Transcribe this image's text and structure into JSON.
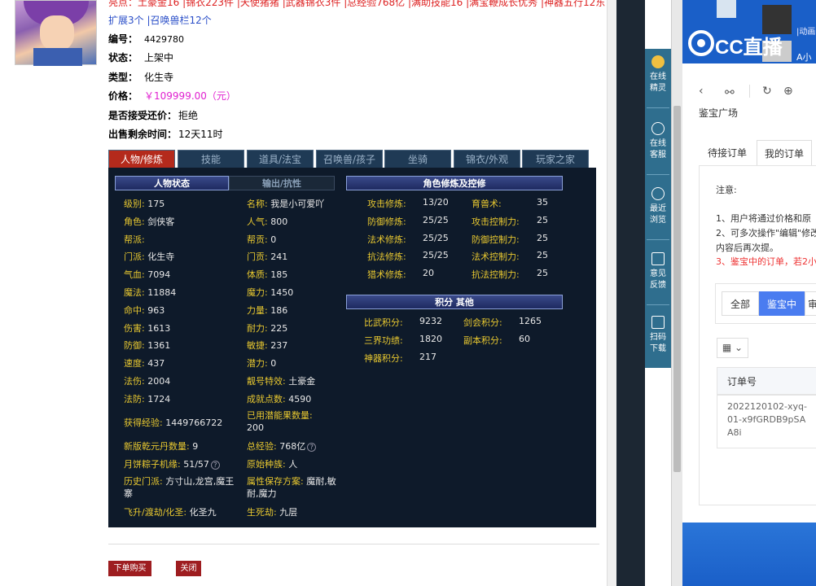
{
  "listing": {
    "top_line1": "亮点：土豪金16 |锦衣223件 |天使猪猪 |武器锦衣3件 |总经验768亿 |满助技能16 |满宝鞭成长优秀 |神器五行12东 |符咒",
    "top_line2": "扩展3个 |召唤兽栏12个",
    "id_label": "编号：",
    "id_value": "4429780",
    "status_label": "状态：",
    "status_value": "上架中",
    "type_label": "类型：",
    "type_value": "化生寺",
    "price_label": "价格：",
    "price_value": "￥109999.00（元）",
    "bargain_label": "是否接受还价：",
    "bargain_value": "拒绝",
    "time_label": "出售剩余时间：",
    "time_value": "12天11时"
  },
  "tabs": [
    "人物/修炼",
    "技能",
    "道具/法宝",
    "召唤兽/孩子",
    "坐骑",
    "锦衣/外观",
    "玩家之家"
  ],
  "panel": {
    "status_header": "人物状态",
    "output_header": "输出/抗性",
    "cultivation_header": "角色修炼及控修",
    "points_header": "积分 其他",
    "left_col": [
      {
        "label": "级别:",
        "value": "175"
      },
      {
        "label": "角色:",
        "value": "剑侠客"
      },
      {
        "label": "帮派:",
        "value": ""
      },
      {
        "label": "门派:",
        "value": "化生寺"
      },
      {
        "label": "气血:",
        "value": "7094"
      },
      {
        "label": "魔法:",
        "value": "11884"
      },
      {
        "label": "命中:",
        "value": "963"
      },
      {
        "label": "伤害:",
        "value": "1613"
      },
      {
        "label": "防御:",
        "value": "1361"
      },
      {
        "label": "速度:",
        "value": "437"
      },
      {
        "label": "法伤:",
        "value": "2004"
      },
      {
        "label": "法防:",
        "value": "1724"
      }
    ],
    "mid_col": [
      {
        "label": "名称:",
        "value": "我是小可爱吖"
      },
      {
        "label": "人气:",
        "value": "800"
      },
      {
        "label": "帮贡:",
        "value": "0"
      },
      {
        "label": "门贡:",
        "value": "241"
      },
      {
        "label": "体质:",
        "value": "185"
      },
      {
        "label": "魔力:",
        "value": "1450"
      },
      {
        "label": "力量:",
        "value": "186"
      },
      {
        "label": "耐力:",
        "value": "225"
      },
      {
        "label": "敏捷:",
        "value": "237"
      },
      {
        "label": "潜力:",
        "value": "0"
      },
      {
        "label": "靓号特效:",
        "value": "土豪金"
      },
      {
        "label": "成就点数:",
        "value": "4590"
      }
    ],
    "extra": {
      "exp_label": "获得经验:",
      "exp_value": "1449766722",
      "fruit_label": "已用潜能果数量:",
      "fruit_value": "200",
      "qianyuan_label": "新版乾元丹数量:",
      "qianyuan_value": "9",
      "totalexp_label": "总经验:",
      "totalexp_value": "768亿",
      "moon_label": "月饼粽子机缘:",
      "moon_value": "51/57",
      "race_label": "原始种族:",
      "race_value": "人",
      "history_label": "历史门派:",
      "history_value": "方寸山,龙宫,魔王寨",
      "attr_label": "属性保存方案:",
      "attr_value": "魔耐,敏耐,魔力",
      "fly_label": "飞升/渡劫/化圣:",
      "fly_value": "化圣九",
      "death_label": "生死劫:",
      "death_value": "九层"
    },
    "cultivation": [
      {
        "l1": "攻击修炼:",
        "v1": "13/20",
        "l2": "育兽术:",
        "v2": "35"
      },
      {
        "l1": "防御修炼:",
        "v1": "25/25",
        "l2": "攻击控制力:",
        "v2": "25"
      },
      {
        "l1": "法术修炼:",
        "v1": "25/25",
        "l2": "防御控制力:",
        "v2": "25"
      },
      {
        "l1": "抗法修炼:",
        "v1": "25/25",
        "l2": "法术控制力:",
        "v2": "25"
      },
      {
        "l1": "猎术修炼:",
        "v1": "20",
        "l2": "抗法控制力:",
        "v2": "25"
      }
    ],
    "points": [
      {
        "l1": "比武积分:",
        "v1": "9232",
        "l2": "剑会积分:",
        "v2": "1265"
      },
      {
        "l1": "三界功绩:",
        "v1": "1820",
        "l2": "副本积分:",
        "v2": "60"
      },
      {
        "l1": "神器积分:",
        "v1": "217",
        "l2": "",
        "v2": ""
      }
    ]
  },
  "buttons": {
    "buy": "下单购买",
    "close": "关闭"
  },
  "sidebar": [
    {
      "label": "在线精灵"
    },
    {
      "label": "在线客服"
    },
    {
      "label": "最近浏览"
    },
    {
      "label": "意见反馈"
    },
    {
      "label": "扫码下载"
    }
  ],
  "right_app": {
    "brand": "CC直播",
    "top_right_1": "|动画",
    "top_right_2": "A小",
    "page_title": "鉴宝广场",
    "tab1": "待接订单",
    "tab2": "我的订单",
    "notice_title": "注意:",
    "notice1": "1、用户将通过价格和原",
    "notice2": "2、可多次操作\"编辑\"修改",
    "notice3": "内容后再次提。",
    "notice4": "3、鉴宝中的订单，若2小",
    "seg_all": "全部",
    "seg_active": "鉴宝中",
    "seg_third": "审",
    "col_order": "订单号",
    "order_no": "2022120102-xyq-01-x9fGRDB9pSAA8i"
  },
  "colors": {
    "accent_red": "#9e1d20",
    "price": "#e020d0",
    "panel_bg": "#0e1a2a",
    "label_gold": "#e8c830",
    "brand_blue": "#1a5fc8",
    "sidebar_teal": "#2f6e8e"
  }
}
